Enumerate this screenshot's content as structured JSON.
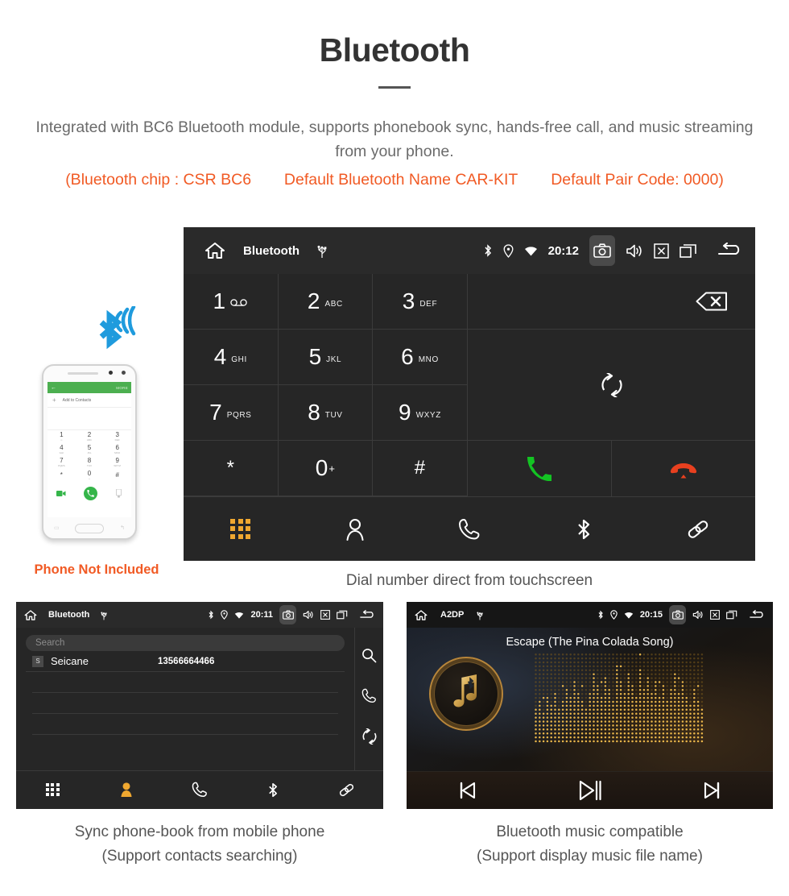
{
  "header": {
    "title": "Bluetooth",
    "intro": "Integrated with BC6 Bluetooth module, supports phonebook sync, hands-free call, and music streaming from your phone.",
    "spec_open": "(Bluetooth chip : CSR BC6",
    "spec_name": "Default Bluetooth Name CAR-KIT",
    "spec_code": "Default Pair Code: 0000)"
  },
  "colors": {
    "accent_orange": "#f15a24",
    "key_active": "#f0a830",
    "call_green": "#13c323",
    "hangup_red": "#e8401f",
    "panel_bg": "#262626",
    "status_bar": "#2a2a2a"
  },
  "dialer": {
    "status": {
      "home": "home-icon",
      "title": "Bluetooth",
      "usb": "usb-icon",
      "bluetooth": "bluetooth-icon",
      "location": "location-icon",
      "wifi": "wifi-icon",
      "time": "20:12",
      "camera": "camera-icon",
      "volume": "volume-icon",
      "close": "close-box-icon",
      "recents": "recents-icon",
      "back": "back-arrow-icon"
    },
    "keys": [
      {
        "digit": "1",
        "sub": "",
        "icon": "voicemail-icon"
      },
      {
        "digit": "2",
        "sub": "ABC",
        "icon": ""
      },
      {
        "digit": "3",
        "sub": "DEF",
        "icon": ""
      },
      {
        "digit": "4",
        "sub": "GHI",
        "icon": ""
      },
      {
        "digit": "5",
        "sub": "JKL",
        "icon": ""
      },
      {
        "digit": "6",
        "sub": "MNO",
        "icon": ""
      },
      {
        "digit": "7",
        "sub": "PQRS",
        "icon": ""
      },
      {
        "digit": "8",
        "sub": "TUV",
        "icon": ""
      },
      {
        "digit": "9",
        "sub": "WXYZ",
        "icon": ""
      },
      {
        "digit": "*",
        "sub": "",
        "icon": ""
      },
      {
        "digit": "0",
        "sub": "",
        "icon": "plus-sign"
      },
      {
        "digit": "#",
        "sub": "",
        "icon": ""
      }
    ],
    "actions": {
      "backspace": "backspace-icon",
      "sync": "sync-icon",
      "call": "call-icon",
      "hangup": "hangup-icon"
    },
    "nav": [
      {
        "name": "keypad",
        "icon": "keypad-icon",
        "active": true
      },
      {
        "name": "contacts",
        "icon": "contacts-icon",
        "active": false
      },
      {
        "name": "call-log",
        "icon": "phone-handset-icon",
        "active": false
      },
      {
        "name": "bluetooth",
        "icon": "bluetooth-icon",
        "active": false
      },
      {
        "name": "pair-link",
        "icon": "link-icon",
        "active": false
      }
    ],
    "caption": "Dial number direct from touchscreen"
  },
  "phone_illustration": {
    "topbar_back": "←",
    "topbar_more": "MORE",
    "add_label": "Add to Contacts",
    "add_plus": "+",
    "keys": [
      {
        "digit": "1",
        "sub": "∞"
      },
      {
        "digit": "2",
        "sub": "ABC"
      },
      {
        "digit": "3",
        "sub": "DEF"
      },
      {
        "digit": "4",
        "sub": "GHI"
      },
      {
        "digit": "5",
        "sub": "JKL"
      },
      {
        "digit": "6",
        "sub": "MNO"
      },
      {
        "digit": "7",
        "sub": "PQRS"
      },
      {
        "digit": "8",
        "sub": "TUV"
      },
      {
        "digit": "9",
        "sub": "WXYZ"
      },
      {
        "digit": "*",
        "sub": ""
      },
      {
        "digit": "0",
        "sub": "+"
      },
      {
        "digit": "#",
        "sub": ""
      }
    ],
    "caption": "Phone Not Included"
  },
  "contacts_panel": {
    "status": {
      "title": "Bluetooth",
      "time": "20:11"
    },
    "search_placeholder": "Search",
    "rows": [
      {
        "badge": "S",
        "name": "Seicane",
        "number": "13566664466"
      }
    ],
    "side_actions": [
      {
        "name": "search",
        "icon": "search-icon"
      },
      {
        "name": "call",
        "icon": "phone-handset-icon"
      },
      {
        "name": "sync",
        "icon": "sync-icon"
      }
    ],
    "nav": [
      {
        "name": "keypad",
        "icon": "keypad-icon",
        "active": false
      },
      {
        "name": "contacts",
        "icon": "contacts-icon",
        "active": true
      },
      {
        "name": "call-log",
        "icon": "phone-handset-icon",
        "active": false
      },
      {
        "name": "bluetooth",
        "icon": "bluetooth-icon",
        "active": false
      },
      {
        "name": "pair-link",
        "icon": "link-icon",
        "active": false
      }
    ],
    "caption_line1": "Sync phone-book from mobile phone",
    "caption_line2": "(Support contacts searching)"
  },
  "music_panel": {
    "status": {
      "title": "A2DP",
      "time": "20:15"
    },
    "song_title": "Escape (The Pina Colada Song)",
    "album_icon": "music-note-bluetooth-icon",
    "controls": [
      {
        "name": "previous",
        "icon": "skip-previous-icon"
      },
      {
        "name": "play-pause",
        "icon": "play-pause-icon"
      },
      {
        "name": "next",
        "icon": "skip-next-icon"
      }
    ],
    "caption_line1": "Bluetooth music compatible",
    "caption_line2": "(Support display music file name)"
  }
}
